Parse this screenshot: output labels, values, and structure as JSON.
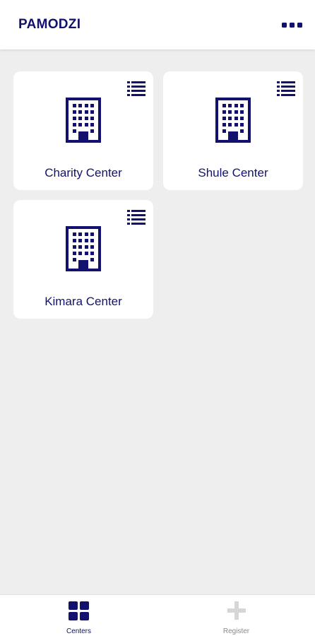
{
  "header": {
    "title": "PAMODZI",
    "menu_icon": "more-horizontal-icon"
  },
  "centers": [
    {
      "label": "Charity Center",
      "icon": "building-icon",
      "menu_icon": "list-icon"
    },
    {
      "label": "Shule Center",
      "icon": "building-icon",
      "menu_icon": "list-icon"
    },
    {
      "label": "Kimara Center",
      "icon": "building-icon",
      "menu_icon": "list-icon"
    }
  ],
  "bottom_nav": {
    "items": [
      {
        "label": "Centers",
        "icon": "grid-icon",
        "active": true
      },
      {
        "label": "Register",
        "icon": "plus-icon",
        "active": false
      }
    ]
  },
  "colors": {
    "primary": "#12126e",
    "background": "#eeeeee",
    "card": "#ffffff",
    "inactive": "#d6d6d6"
  }
}
